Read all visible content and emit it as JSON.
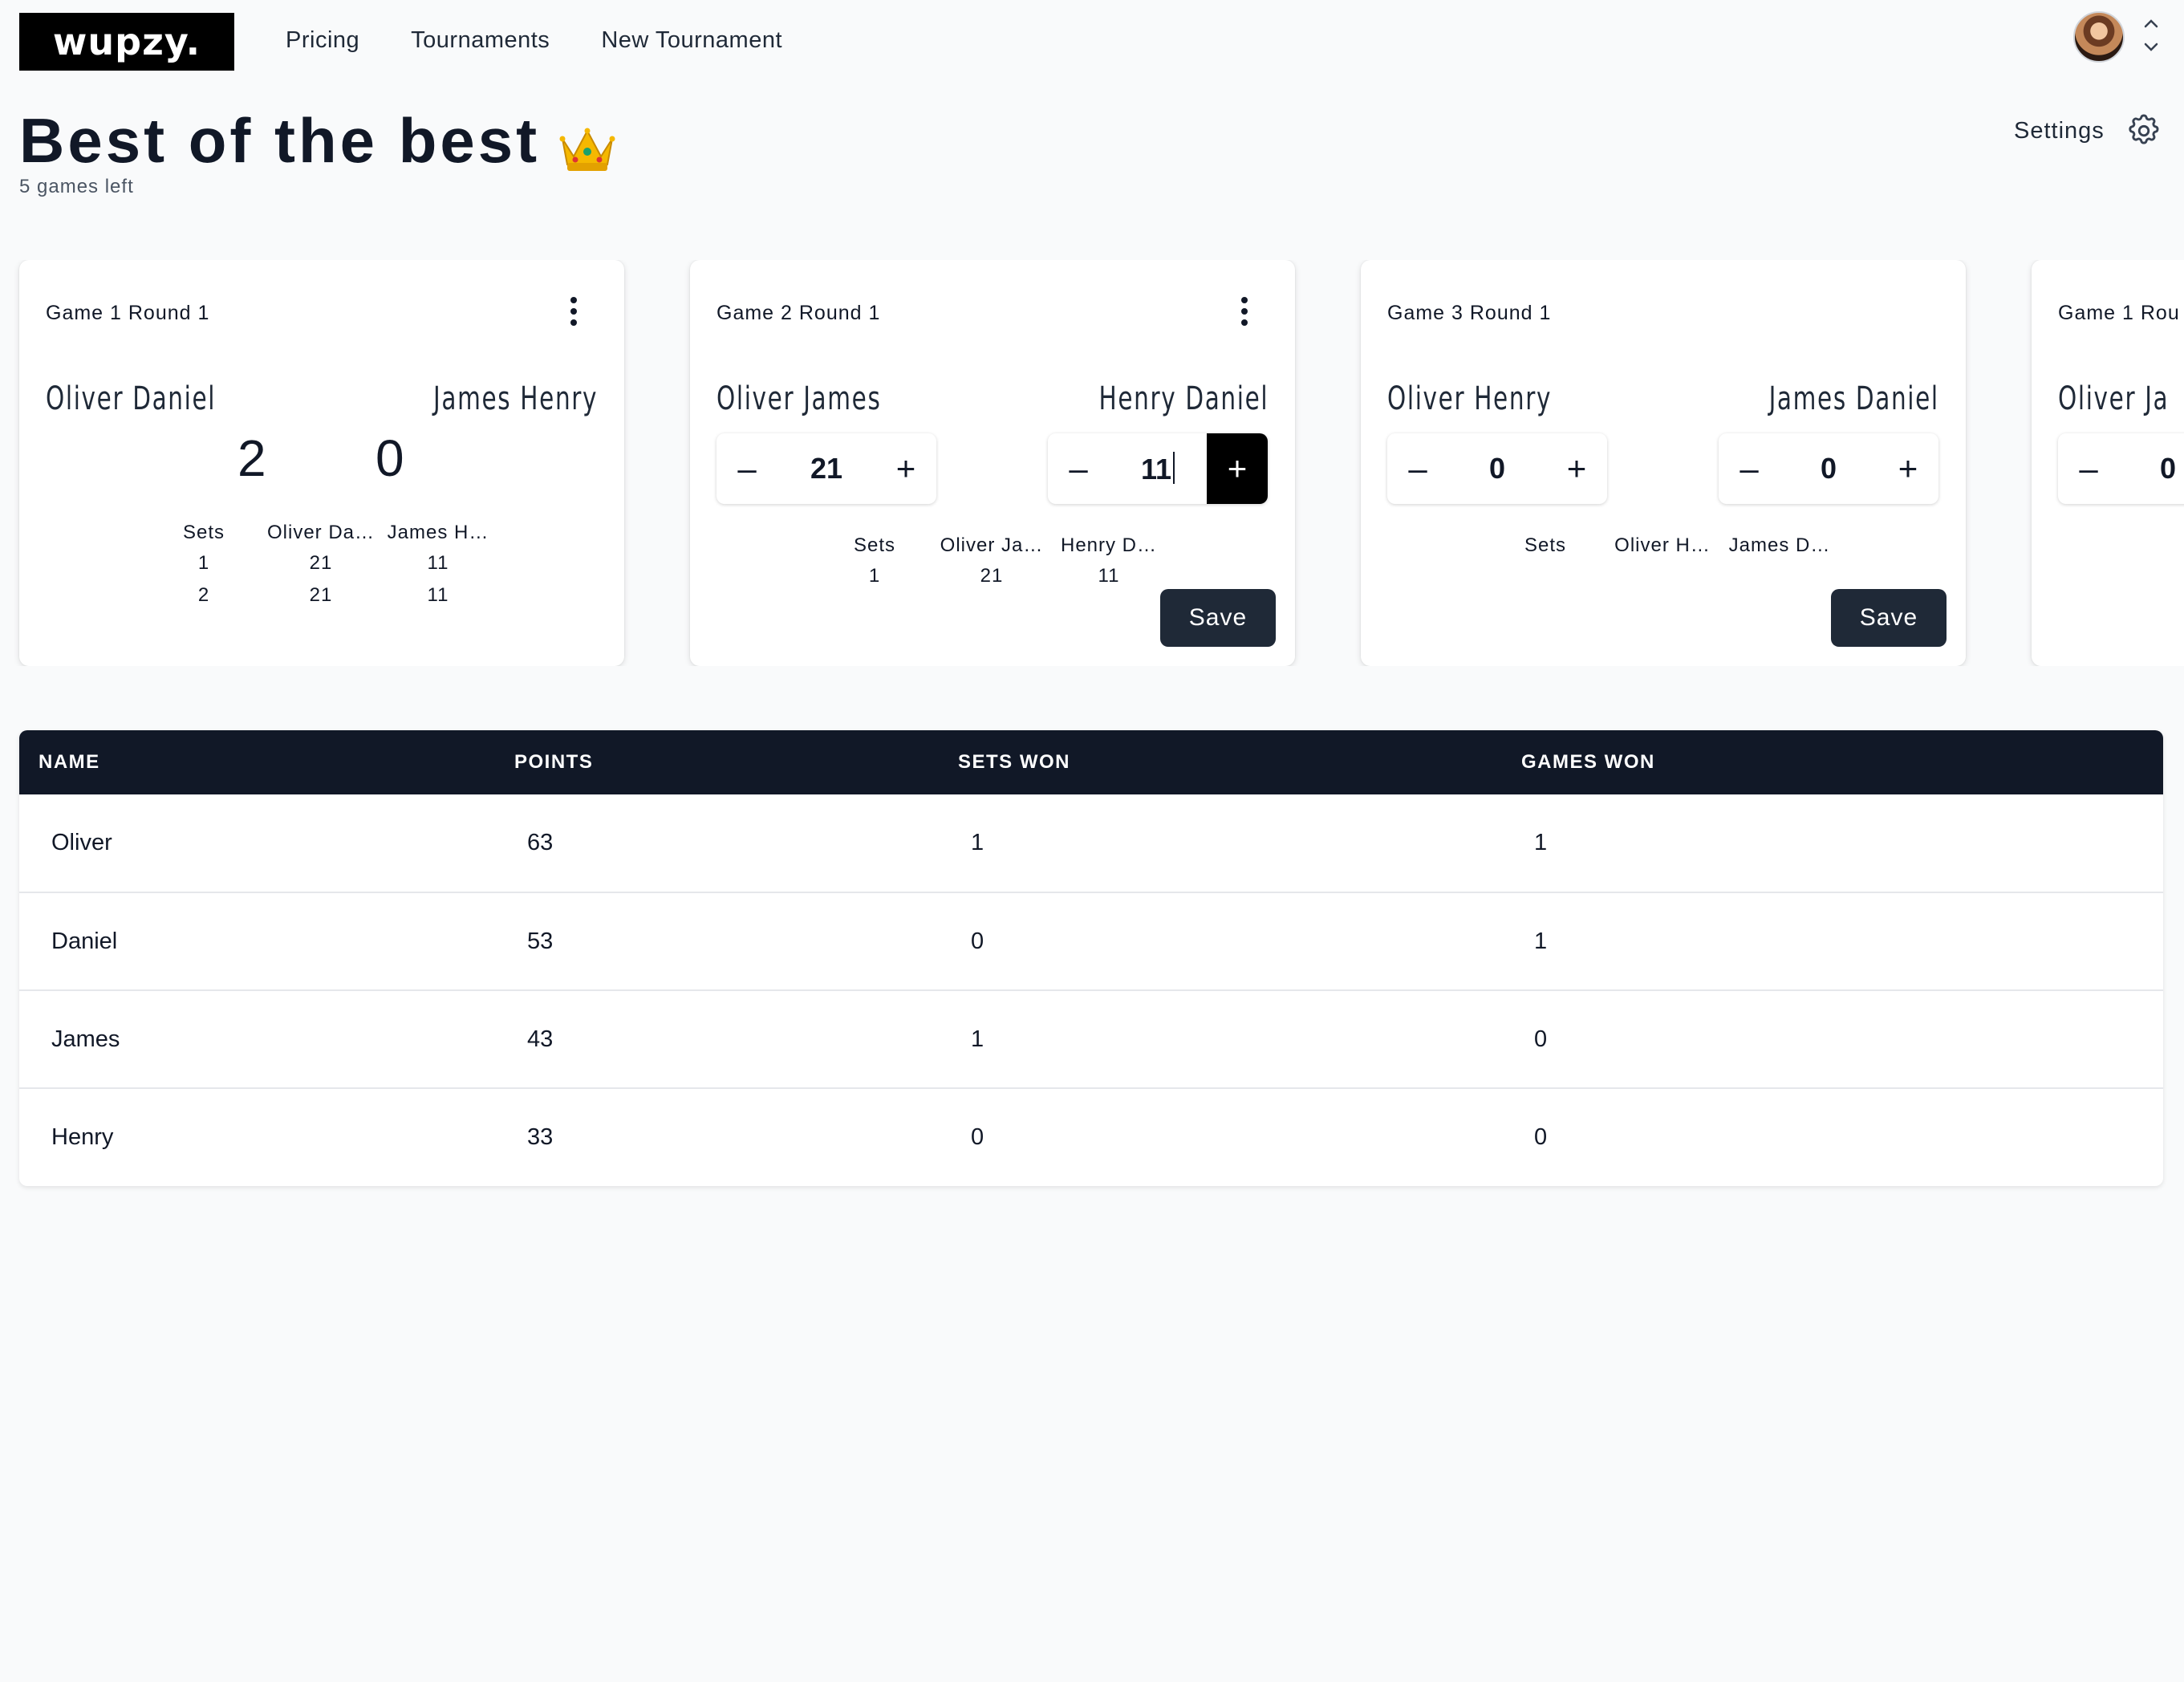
{
  "brand": {
    "logo": "wupzy."
  },
  "nav": {
    "items": [
      "Pricing",
      "Tournaments",
      "New Tournament"
    ]
  },
  "page": {
    "title": "Best of the best",
    "subtitle": "5 games left",
    "settings_label": "Settings"
  },
  "games": [
    {
      "title": "Game 1 Round 1",
      "team_a": "Oliver Daniel",
      "team_b": "James Henry",
      "score_a": "2",
      "score_b": "0",
      "sets_header": [
        "Sets",
        "Oliver Da…",
        "James H…"
      ],
      "sets": [
        [
          "1",
          "21",
          "11"
        ],
        [
          "2",
          "21",
          "11"
        ]
      ]
    },
    {
      "title": "Game 2 Round 1",
      "team_a": "Oliver James",
      "team_b": "Henry Daniel",
      "score_a": "21",
      "score_b": "11",
      "sets_header": [
        "Sets",
        "Oliver Ja…",
        "Henry D…"
      ],
      "sets": [
        [
          "1",
          "21",
          "11"
        ]
      ],
      "save_label": "Save"
    },
    {
      "title": "Game 3 Round 1",
      "team_a": "Oliver Henry",
      "team_b": "James Daniel",
      "score_a": "0",
      "score_b": "0",
      "sets_header": [
        "Sets",
        "Oliver H…",
        "James D…"
      ],
      "save_label": "Save"
    },
    {
      "title": "Game 1 Rou",
      "team_a": "Oliver Ja",
      "score_a": "0"
    }
  ],
  "stepper": {
    "minus": "–",
    "plus": "+"
  },
  "standings": {
    "headers": [
      "NAME",
      "POINTS",
      "SETS WON",
      "GAMES WON"
    ],
    "rows": [
      [
        "Oliver",
        "63",
        "1",
        "1"
      ],
      [
        "Daniel",
        "53",
        "0",
        "1"
      ],
      [
        "James",
        "43",
        "1",
        "0"
      ],
      [
        "Henry",
        "33",
        "0",
        "0"
      ]
    ]
  },
  "icons": {
    "title_emoji": "crown-icon",
    "settings": "gear-icon",
    "avatar_switch": "chevron-up-down-icon",
    "game_menu": "kebab-menu-icon"
  }
}
